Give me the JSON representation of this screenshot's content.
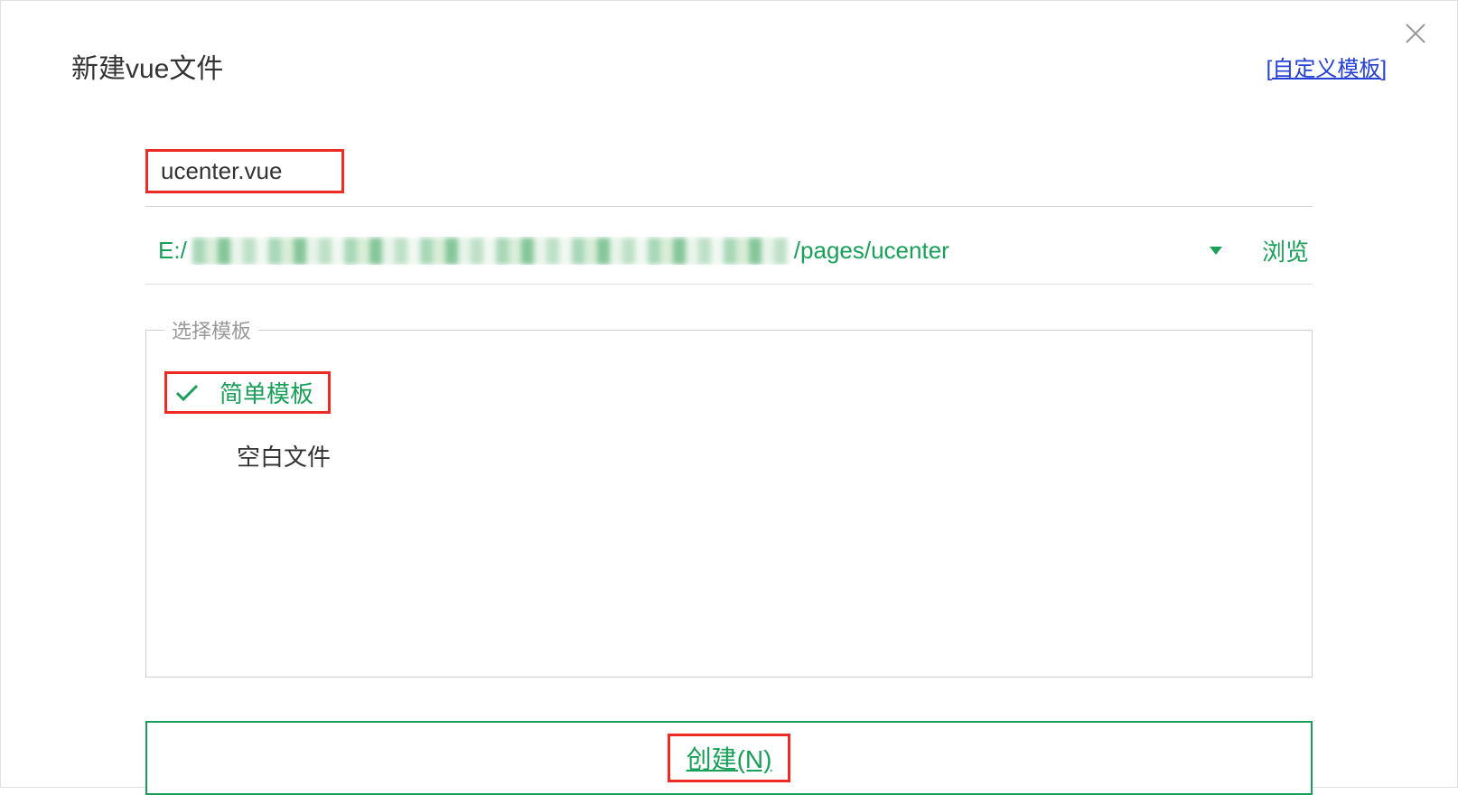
{
  "header": {
    "title": "新建vue文件",
    "custom_template_link": "[自定义模板]"
  },
  "filename": {
    "value": "ucenter.vue"
  },
  "path": {
    "prefix": "E:/",
    "suffix": "/pages/ucenter",
    "browse_label": "浏览"
  },
  "templates": {
    "legend": "选择模板",
    "items": [
      {
        "label": "简单模板",
        "selected": true
      },
      {
        "label": "空白文件",
        "selected": false
      }
    ]
  },
  "footer": {
    "create_label": "创建(N)"
  }
}
